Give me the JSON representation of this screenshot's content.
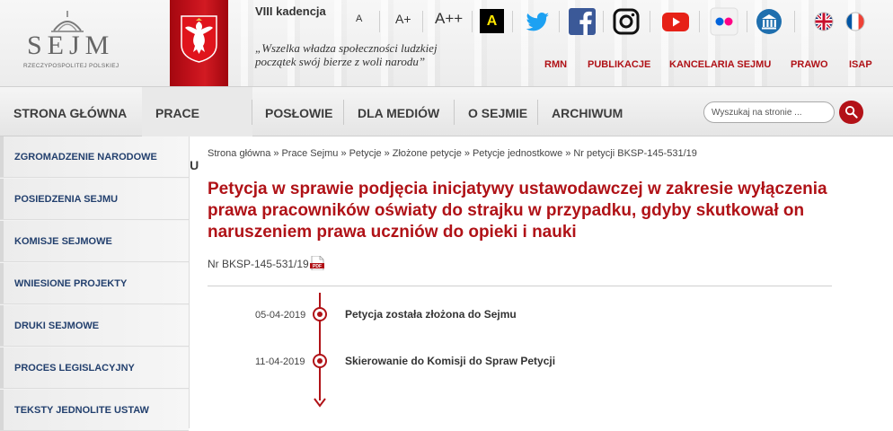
{
  "header": {
    "logo_text": "SEJM",
    "logo_sub": "RZECZYPOSPOLITEJ POLSKIEJ",
    "kadencja": "VIII kadencja",
    "motto_line1": "„Wszelka władza społeczności ludzkiej",
    "motto_line2": "początek swój bierze z woli narodu”",
    "accessibility": {
      "font_small": "A",
      "font_medium": "A+",
      "font_large": "A++",
      "contrast": "A"
    },
    "social_icons": [
      "twitter-icon",
      "facebook-icon",
      "instagram-icon",
      "youtube-icon",
      "flickr-icon",
      "institution-icon"
    ],
    "languages": [
      "english-flag-icon",
      "french-flag-icon"
    ],
    "top_links": [
      "RMN",
      "PUBLIKACJE",
      "KANCELARIA SEJMU",
      "PRAWO",
      "ISAP"
    ]
  },
  "nav": {
    "items": [
      "STRONA GŁÓWNA",
      "PRACE SEJMU",
      "POSŁOWIE",
      "DLA MEDIÓW",
      "O SEJMIE",
      "ARCHIWUM"
    ],
    "active": "PRACE SEJMU",
    "search_placeholder": "Wyszukaj na stronie ..."
  },
  "sidebar": {
    "items": [
      "ZGROMADZENIE NARODOWE",
      "POSIEDZENIA SEJMU",
      "KOMISJE SEJMOWE",
      "WNIESIONE PROJEKTY",
      "DRUKI SEJMOWE",
      "PROCES LEGISLACYJNY",
      "TEKSTY JEDNOLITE USTAW"
    ]
  },
  "main": {
    "breadcrumb": [
      "Strona główna",
      "Prace Sejmu",
      "Petycje",
      "Złożone petycje",
      "Petycje jednostkowe",
      "Nr petycji BKSP-145-531/19"
    ],
    "breadcrumb_sep": "»",
    "title": "Petycja w sprawie podjęcia inicjatywy ustawodawczej w zakresie wyłączenia prawa pracowników oświaty do strajku w przypadku, gdyby skutkował on naruszeniem prawa uczniów do opieki i nauki",
    "petition_number": "Nr BKSP-145-531/19",
    "timeline": [
      {
        "date": "05-04-2019",
        "text": "Petycja została złożona do Sejmu"
      },
      {
        "date": "11-04-2019",
        "text": "Skierowanie do Komisji do Spraw Petycji"
      }
    ]
  },
  "colors": {
    "accent": "#b01217",
    "sidebar_text": "#23406e",
    "flag_red": "#c5121c"
  }
}
